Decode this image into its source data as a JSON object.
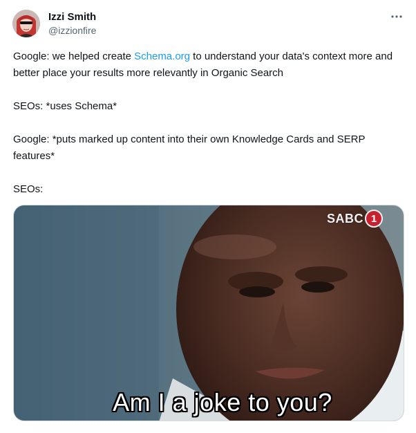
{
  "author": {
    "display_name": "Izzi Smith",
    "handle": "@izzionfire",
    "avatar_icon": "profile-photo"
  },
  "menu": {
    "more_icon": "ellipsis-icon"
  },
  "tweet": {
    "line1_prefix": "Google: we helped create ",
    "line1_link": "Schema.org",
    "line1_suffix": " to understand your data's context more and better place your results more relevantly in Organic Search",
    "line2": "SEOs: *uses Schema*",
    "line3": "Google: *puts marked up content into their own Knowledge Cards and SERP features*",
    "line4": "SEOs:"
  },
  "media": {
    "caption": "Am I a joke to you?",
    "watermark_text": "SABC",
    "watermark_number": "1"
  },
  "colors": {
    "link": "#1d9bf0",
    "text": "#0f1419",
    "secondary": "#536471"
  }
}
